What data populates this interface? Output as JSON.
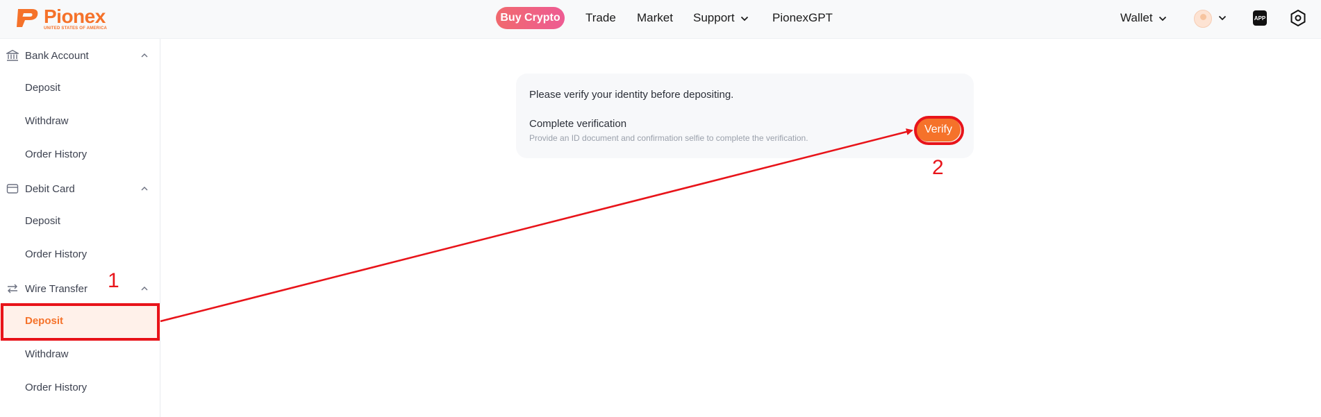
{
  "header": {
    "logo": {
      "name": "Pionex",
      "subtitle": "UNITED STATES OF AMERICA"
    },
    "nav": {
      "buy_crypto": "Buy Crypto",
      "trade": "Trade",
      "market": "Market",
      "support": "Support",
      "pionex_gpt": "PionexGPT"
    },
    "wallet": "Wallet",
    "icons": [
      "user-avatar",
      "app-download-icon",
      "settings-icon"
    ]
  },
  "sidebar": {
    "sections": [
      {
        "label": "Bank Account",
        "icon": "bank-icon",
        "items": [
          "Deposit",
          "Withdraw",
          "Order History"
        ]
      },
      {
        "label": "Debit Card",
        "icon": "card-icon",
        "items": [
          "Deposit",
          "Order History"
        ]
      },
      {
        "label": "Wire Transfer",
        "icon": "transfer-icon",
        "items": [
          "Deposit",
          "Withdraw",
          "Order History"
        ]
      }
    ],
    "active": "Wire Transfer / Deposit"
  },
  "main": {
    "message": "Please verify your identity before depositing.",
    "verification_title": "Complete verification",
    "verification_desc": "Provide an ID document and confirmation selfie to complete the verification.",
    "verify_button": "Verify"
  },
  "annotations": {
    "step1": "1",
    "step2": "2"
  },
  "colors": {
    "brand": "#f5722a",
    "annotation": "#e8141a",
    "buy_gradient_start": "#f0696e",
    "buy_gradient_end": "#ee5b93"
  }
}
